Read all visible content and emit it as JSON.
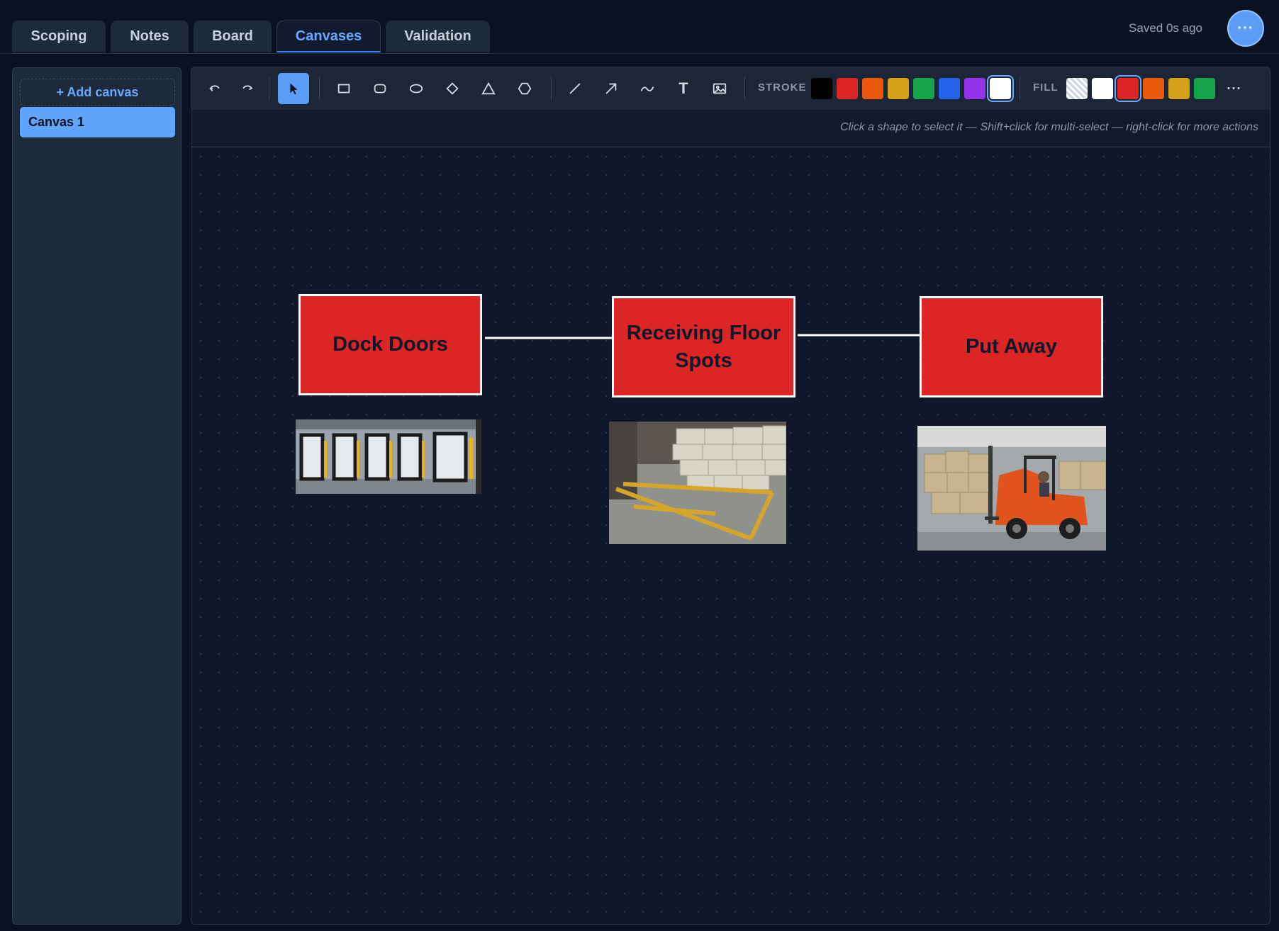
{
  "tabs": [
    {
      "label": "Scoping"
    },
    {
      "label": "Notes"
    },
    {
      "label": "Board"
    },
    {
      "label": "Canvases",
      "active": true
    },
    {
      "label": "Validation"
    }
  ],
  "status": {
    "saved": "Saved 0s ago"
  },
  "menu_button": {
    "label": "···"
  },
  "sidebar": {
    "add_canvas": "+ Add canvas",
    "canvases": [
      {
        "label": "Canvas 1",
        "selected": true
      }
    ]
  },
  "toolbar": {
    "tools": [
      "undo-icon",
      "redo-icon",
      "select-icon",
      "rectangle-icon",
      "rounded-rectangle-icon",
      "ellipse-icon",
      "diamond-icon",
      "triangle-icon",
      "hexagon-icon",
      "line-icon",
      "arrow-icon",
      "freehand-icon",
      "text-icon",
      "image-icon"
    ],
    "active_tool": "select-icon",
    "text_tool_glyph": "T",
    "stroke_label": "STROKE",
    "stroke_colors": [
      "#000000",
      "#dc2626",
      "#ea580c",
      "#d4a017",
      "#16a34a",
      "#2563eb",
      "#9333ea",
      "#ffffff"
    ],
    "stroke_selected": "#ffffff",
    "fill_label": "FILL",
    "fill_colors": [
      "transparent",
      "#ffffff",
      "#dc2626",
      "#ea580c",
      "#d4a017",
      "#16a34a"
    ],
    "fill_selected": "#dc2626",
    "more_label": "···"
  },
  "hint": "Click a shape to select it — Shift+click for multi-select — right-click for more actions",
  "diagram": {
    "nodes": [
      {
        "label": "Dock Doors",
        "fill": "#dc2626",
        "stroke": "#ffffff"
      },
      {
        "label": "Receiving Floor Spots",
        "fill": "#dc2626",
        "stroke": "#ffffff"
      },
      {
        "label": "Put Away",
        "fill": "#dc2626",
        "stroke": "#ffffff"
      }
    ],
    "edges": [
      {
        "from": "Dock Doors",
        "to": "Receiving Floor Spots"
      },
      {
        "from": "Receiving Floor Spots",
        "to": "Put Away"
      }
    ],
    "images": [
      {
        "depicts": "dock-doors-photo"
      },
      {
        "depicts": "receiving-floor-photo"
      },
      {
        "depicts": "forklift-photo"
      }
    ]
  }
}
